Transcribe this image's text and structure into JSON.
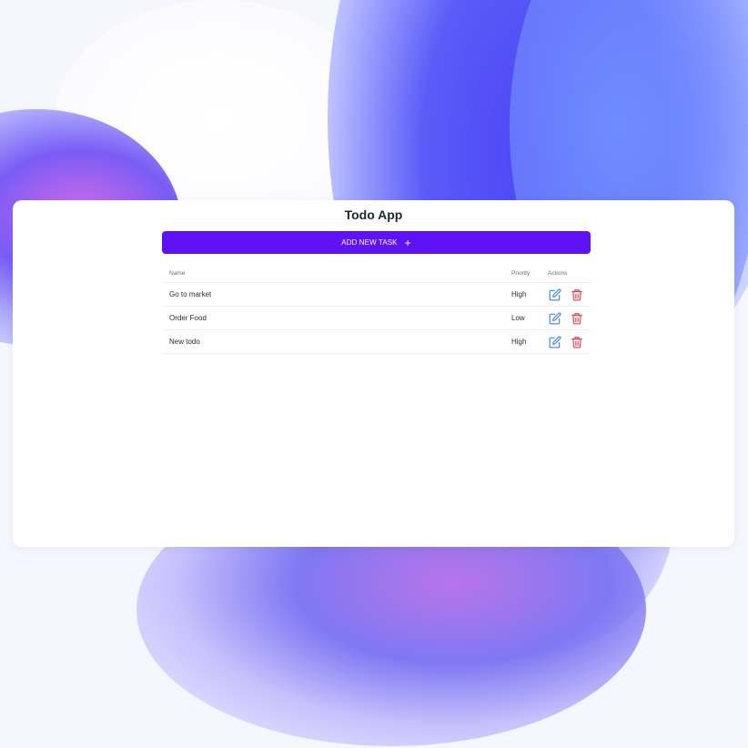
{
  "app": {
    "title": "Todo App",
    "add_button_label": "ADD NEW TASK",
    "add_button_icon": "plus-icon"
  },
  "table": {
    "columns": {
      "name": "Name",
      "priority": "Priority",
      "actions": "Actions"
    },
    "rows": [
      {
        "name": "Go to market",
        "priority": "High"
      },
      {
        "name": "Order Food",
        "priority": "Low"
      },
      {
        "name": "New todo",
        "priority": "High"
      }
    ],
    "row_action_icons": [
      "edit-icon",
      "trash-icon"
    ]
  },
  "colors": {
    "accent": "#5e12f6",
    "edit_icon": "#3d83ee",
    "delete_icon": "#e0414a",
    "title_text": "#1f2733"
  }
}
